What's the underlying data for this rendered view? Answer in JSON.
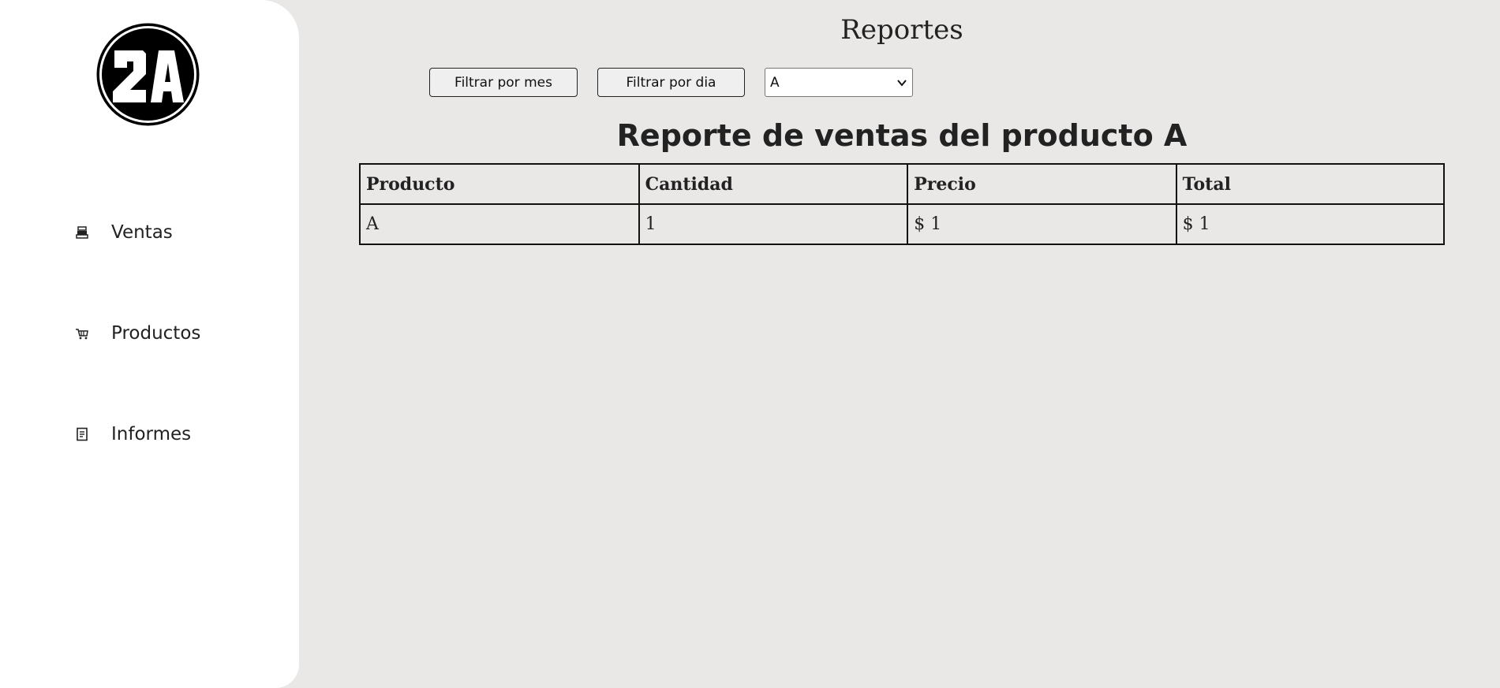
{
  "sidebar": {
    "logo_icon": "2a-logo",
    "logo_text": "2A",
    "items": [
      {
        "label": "Ventas",
        "icon": "cash-register-icon"
      },
      {
        "label": "Productos",
        "icon": "cart-icon"
      },
      {
        "label": "Informes",
        "icon": "report-icon"
      }
    ]
  },
  "main": {
    "title": "Reportes",
    "filters": {
      "month_button": "Filtrar por mes",
      "day_button": "Filtrar por dia",
      "product_select": {
        "selected": "A"
      }
    },
    "report": {
      "heading": "Reporte de ventas del producto A",
      "columns": [
        "Producto",
        "Cantidad",
        "Precio",
        "Total"
      ],
      "rows": [
        [
          "A",
          "1",
          "$ 1",
          "$ 1"
        ]
      ]
    }
  },
  "colors": {
    "background": "#e9e8e7",
    "sidebar": "#ffffff",
    "text": "#222222"
  }
}
